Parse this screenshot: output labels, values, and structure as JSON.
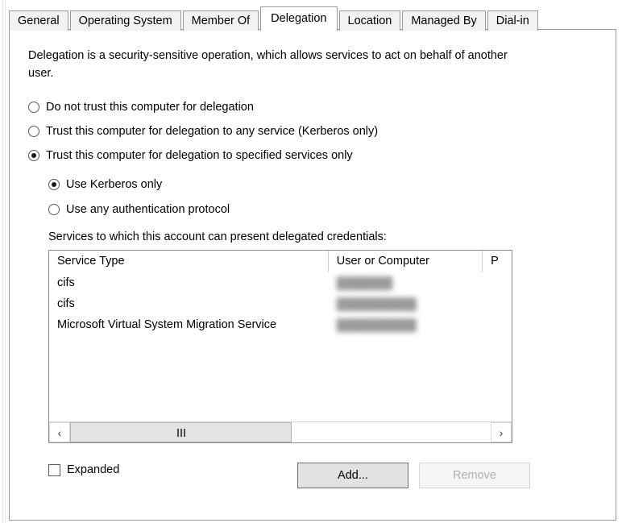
{
  "window": {
    "active_tab": "Delegation"
  },
  "tabs": [
    {
      "label": "General",
      "active": false
    },
    {
      "label": "Operating System",
      "active": false
    },
    {
      "label": "Member Of",
      "active": false
    },
    {
      "label": "Delegation",
      "active": true
    },
    {
      "label": "Location",
      "active": false
    },
    {
      "label": "Managed By",
      "active": false
    },
    {
      "label": "Dial-in",
      "active": false
    }
  ],
  "page": {
    "description": "Delegation is a security-sensitive operation, which allows services to act on behalf of another user.",
    "delegation_options": [
      {
        "label": "Do not trust this computer for delegation",
        "selected": false
      },
      {
        "label": "Trust this computer for delegation to any service (Kerberos only)",
        "selected": false
      },
      {
        "label": "Trust this computer for delegation to specified services only",
        "selected": true
      }
    ],
    "auth_options": [
      {
        "label": "Use Kerberos only",
        "selected": true
      },
      {
        "label": "Use any authentication protocol",
        "selected": false
      }
    ],
    "list_label": "Services to which this account can present delegated credentials:",
    "list_columns": [
      {
        "label": "Service Type"
      },
      {
        "label": "User or Computer"
      },
      {
        "label": "P"
      }
    ],
    "list_rows": [
      {
        "service_type": "cifs",
        "user_or_computer": "███████"
      },
      {
        "service_type": "cifs",
        "user_or_computer": "██████████"
      },
      {
        "service_type": "Microsoft Virtual System Migration Service",
        "user_or_computer": "██████████"
      }
    ],
    "scrollbar": {
      "left_arrow": "‹",
      "right_arrow": "›"
    },
    "expanded_checkbox": {
      "label": "Expanded",
      "checked": false
    },
    "add_button": {
      "label": "Add...",
      "enabled": true
    },
    "remove_button": {
      "label": "Remove",
      "enabled": false
    }
  },
  "colors": {
    "panel_bg": "#ffffff",
    "tab_inactive_bg": "#f2f2f2",
    "border": "#9a9a9a",
    "button_face": "#e2e2e2",
    "disabled_text": "#b0b0b0",
    "scroll_thumb": "#e3e3e3"
  }
}
